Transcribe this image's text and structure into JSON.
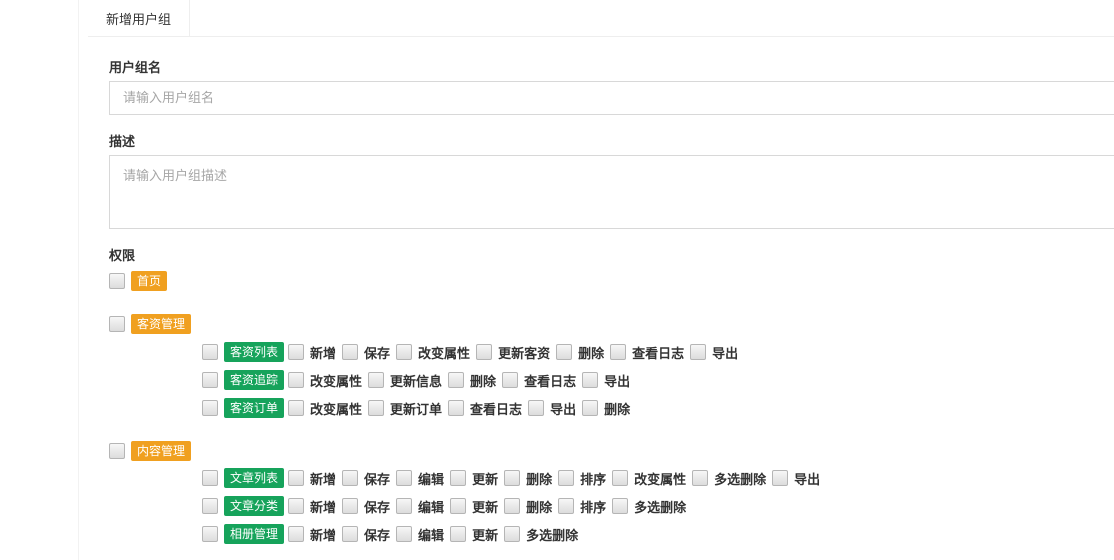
{
  "tab": {
    "label": "新增用户组"
  },
  "form": {
    "name_label": "用户组名",
    "name_placeholder": "请输入用户组名",
    "desc_label": "描述",
    "desc_placeholder": "请输入用户组描述",
    "perm_label": "权限"
  },
  "colors": {
    "orange": "#f0a020",
    "green": "#16a35b"
  },
  "permissions": {
    "home": {
      "label": "首页"
    },
    "customer": {
      "label": "客资管理",
      "rows": [
        {
          "name": "客资列表",
          "actions": [
            "新增",
            "保存",
            "改变属性",
            "更新客资",
            "删除",
            "查看日志",
            "导出"
          ]
        },
        {
          "name": "客资追踪",
          "actions": [
            "改变属性",
            "更新信息",
            "删除",
            "查看日志",
            "导出"
          ]
        },
        {
          "name": "客资订单",
          "actions": [
            "改变属性",
            "更新订单",
            "查看日志",
            "导出",
            "删除"
          ]
        }
      ]
    },
    "content": {
      "label": "内容管理",
      "rows": [
        {
          "name": "文章列表",
          "actions": [
            "新增",
            "保存",
            "编辑",
            "更新",
            "删除",
            "排序",
            "改变属性",
            "多选删除",
            "导出"
          ]
        },
        {
          "name": "文章分类",
          "actions": [
            "新增",
            "保存",
            "编辑",
            "更新",
            "删除",
            "排序",
            "多选删除"
          ]
        },
        {
          "name": "相册管理",
          "actions": [
            "新增",
            "保存",
            "编辑",
            "更新",
            "多选删除"
          ]
        }
      ]
    }
  }
}
